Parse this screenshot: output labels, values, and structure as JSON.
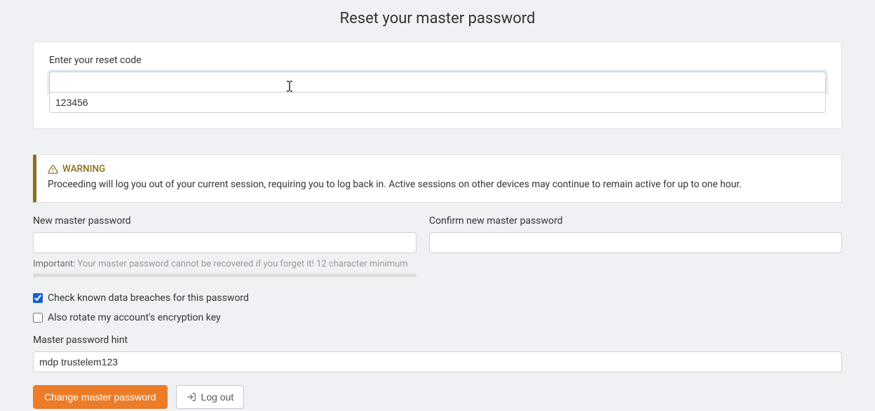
{
  "page": {
    "title": "Reset your master password"
  },
  "reset": {
    "label": "Enter your reset code",
    "input_value": "",
    "suggestion": "123456"
  },
  "warning": {
    "title": "WARNING",
    "text": "Proceeding will log you out of your current session, requiring you to log back in. Active sessions on other devices may continue to remain active for up to one hour."
  },
  "new_password": {
    "label": "New master password",
    "value": "",
    "helper_prefix": "Important:",
    "helper_text": " Your master password cannot be recovered if you forget it! 12 character minimum"
  },
  "confirm_password": {
    "label": "Confirm new master password",
    "value": ""
  },
  "checks": {
    "breach_label": "Check known data breaches for this password",
    "rotate_label": "Also rotate my account's encryption key"
  },
  "hint": {
    "label": "Master password hint",
    "value": "mdp trustelem123"
  },
  "buttons": {
    "primary": "Change master password",
    "logout": "Log out"
  }
}
